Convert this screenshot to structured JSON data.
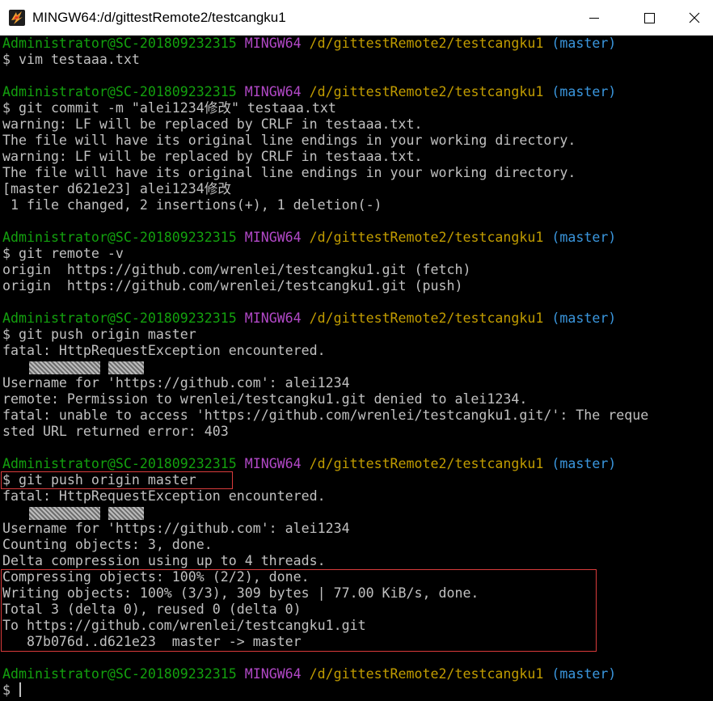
{
  "window": {
    "title": "MINGW64:/d/gittestRemote2/testcangku1",
    "icon": "mingw-app-icon",
    "controls": [
      "minimize-icon",
      "maximize-icon",
      "close-icon"
    ]
  },
  "colors": {
    "background": "#000000",
    "text": "#c0c0c0",
    "user_host": "#13a10e",
    "system": "#b148c6",
    "path": "#c19c00",
    "branch": "#3a96dd",
    "highlight_box": "#d93b3b"
  },
  "terminal": {
    "lines": [
      {
        "type": "prompt",
        "user": "Administrator@SC-201809232315",
        "system": "MINGW64",
        "path": "/d/gittestRemote2/testcangku1",
        "branch": "(master)"
      },
      {
        "type": "text",
        "text": "$ vim testaaa.txt"
      },
      {
        "type": "blank",
        "text": ""
      },
      {
        "type": "prompt",
        "user": "Administrator@SC-201809232315",
        "system": "MINGW64",
        "path": "/d/gittestRemote2/testcangku1",
        "branch": "(master)"
      },
      {
        "type": "text",
        "text": "$ git commit -m \"alei1234修改\" testaaa.txt"
      },
      {
        "type": "text",
        "text": "warning: LF will be replaced by CRLF in testaaa.txt."
      },
      {
        "type": "text",
        "text": "The file will have its original line endings in your working directory."
      },
      {
        "type": "text",
        "text": "warning: LF will be replaced by CRLF in testaaa.txt."
      },
      {
        "type": "text",
        "text": "The file will have its original line endings in your working directory."
      },
      {
        "type": "text",
        "text": "[master d621e23] alei1234修改"
      },
      {
        "type": "text",
        "text": " 1 file changed, 2 insertions(+), 1 deletion(-)"
      },
      {
        "type": "blank",
        "text": ""
      },
      {
        "type": "prompt",
        "user": "Administrator@SC-201809232315",
        "system": "MINGW64",
        "path": "/d/gittestRemote2/testcangku1",
        "branch": "(master)"
      },
      {
        "type": "text",
        "text": "$ git remote -v"
      },
      {
        "type": "text",
        "text": "origin  https://github.com/wrenlei/testcangku1.git (fetch)"
      },
      {
        "type": "text",
        "text": "origin  https://github.com/wrenlei/testcangku1.git (push)"
      },
      {
        "type": "blank",
        "text": ""
      },
      {
        "type": "prompt",
        "user": "Administrator@SC-201809232315",
        "system": "MINGW64",
        "path": "/d/gittestRemote2/testcangku1",
        "branch": "(master)"
      },
      {
        "type": "text",
        "text": "$ git push origin master"
      },
      {
        "type": "text",
        "text": "fatal: HttpRequestException encountered."
      },
      {
        "type": "redacted",
        "text": ""
      },
      {
        "type": "text",
        "text": "Username for 'https://github.com': alei1234"
      },
      {
        "type": "text",
        "text": "remote: Permission to wrenlei/testcangku1.git denied to alei1234."
      },
      {
        "type": "text",
        "text": "fatal: unable to access 'https://github.com/wrenlei/testcangku1.git/': The reque"
      },
      {
        "type": "text",
        "text": "sted URL returned error: 403"
      },
      {
        "type": "blank",
        "text": ""
      },
      {
        "type": "prompt",
        "user": "Administrator@SC-201809232315",
        "system": "MINGW64",
        "path": "/d/gittestRemote2/testcangku1",
        "branch": "(master)"
      },
      {
        "type": "text",
        "text": "$ git push origin master"
      },
      {
        "type": "text",
        "text": "fatal: HttpRequestException encountered."
      },
      {
        "type": "redacted",
        "text": ""
      },
      {
        "type": "text",
        "text": "Username for 'https://github.com': alei1234"
      },
      {
        "type": "text",
        "text": "Counting objects: 3, done."
      },
      {
        "type": "text",
        "text": "Delta compression using up to 4 threads."
      },
      {
        "type": "text",
        "text": "Compressing objects: 100% (2/2), done."
      },
      {
        "type": "text",
        "text": "Writing objects: 100% (3/3), 309 bytes | 77.00 KiB/s, done."
      },
      {
        "type": "text",
        "text": "Total 3 (delta 0), reused 0 (delta 0)"
      },
      {
        "type": "text",
        "text": "To https://github.com/wrenlei/testcangku1.git"
      },
      {
        "type": "text",
        "text": "   87b076d..d621e23  master -> master"
      },
      {
        "type": "blank",
        "text": ""
      },
      {
        "type": "prompt",
        "user": "Administrator@SC-201809232315",
        "system": "MINGW64",
        "path": "/d/gittestRemote2/testcangku1",
        "branch": "(master)"
      },
      {
        "type": "cursor",
        "text": "$ "
      }
    ]
  }
}
